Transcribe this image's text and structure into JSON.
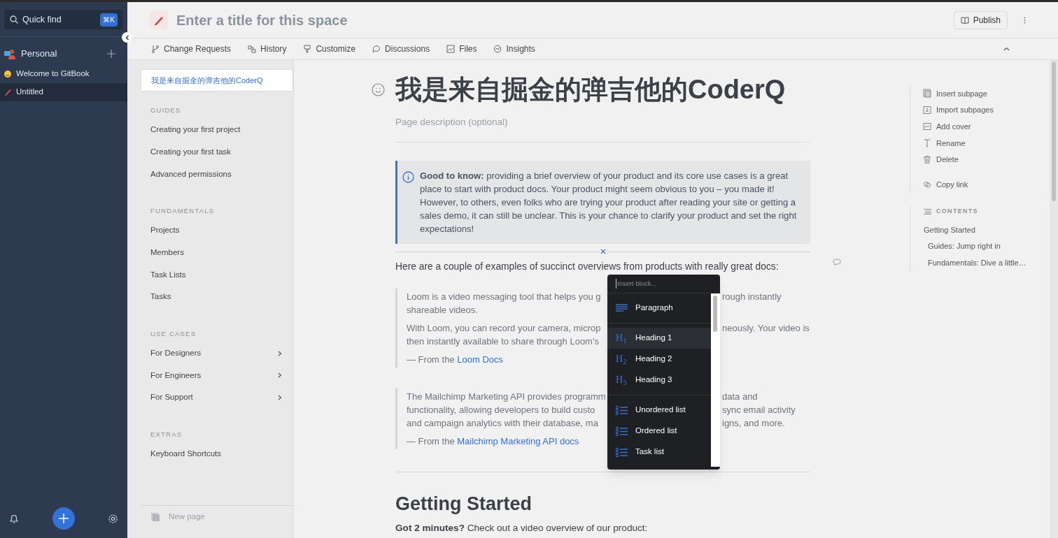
{
  "sidebar": {
    "search": {
      "placeholder": "Quick find",
      "shortcut": "⌘K"
    },
    "space": {
      "name": "Personal"
    },
    "pages": [
      {
        "title": "Welcome to GitBook",
        "kind": "emoji",
        "selected": false
      },
      {
        "title": "Untitled",
        "kind": "pencil",
        "selected": true
      }
    ]
  },
  "header": {
    "title_placeholder": "Enter a title for this space",
    "publish": "Publish"
  },
  "tabs": [
    {
      "label": "Change Requests",
      "kind": "branch"
    },
    {
      "label": "History",
      "kind": "history"
    },
    {
      "label": "Customize",
      "kind": "brush"
    },
    {
      "label": "Discussions",
      "kind": "bubble"
    },
    {
      "label": "Files",
      "kind": "image"
    },
    {
      "label": "Insights",
      "kind": "chart"
    }
  ],
  "nav": {
    "current_page": {
      "title": "我是来自掘金的弹吉他的CoderQ",
      "selected": true
    },
    "sections": [
      {
        "heading": "GUIDES",
        "items": [
          {
            "label": "Creating your first project",
            "expandable": false
          },
          {
            "label": "Creating your first task",
            "expandable": false
          },
          {
            "label": "Advanced permissions",
            "expandable": false
          }
        ]
      },
      {
        "heading": "FUNDAMENTALS",
        "items": [
          {
            "label": "Projects",
            "expandable": false
          },
          {
            "label": "Members",
            "expandable": false
          },
          {
            "label": "Task Lists",
            "expandable": false
          },
          {
            "label": "Tasks",
            "expandable": false
          }
        ]
      },
      {
        "heading": "USE CASES",
        "items": [
          {
            "label": "For Designers",
            "expandable": true
          },
          {
            "label": "For Engineers",
            "expandable": true
          },
          {
            "label": "For Support",
            "expandable": true
          }
        ]
      },
      {
        "heading": "EXTRAS",
        "items": [
          {
            "label": "Keyboard Shortcuts",
            "expandable": false
          }
        ]
      }
    ],
    "new_page": "New page"
  },
  "page": {
    "title": "我是来自掘金的弹吉他的CoderQ",
    "description_placeholder": "Page description (optional)",
    "callout": "**Good to know:** providing a brief overview of your product and its core use cases is a great place to start with product docs. Your product might seem obvious to you – you made it! However, to others, even folks who are trying your product after reading your site or getting a sales demo, it can still be unclear. This is your chance to clarify your product and set the right expectations!",
    "intro": "Here are a couple of examples of succinct overviews from products with really great docs:",
    "quotes": [
      {
        "paragraphs": [
          [
            {
              "left": "Loom is a video messaging tool that helps you g",
              "right": "rough instantly"
            },
            {
              "left": "shareable videos."
            }
          ],
          [
            {
              "left": "With Loom, you can record your camera, microp",
              "right": "neously. Your video is"
            },
            {
              "left": "then instantly available to share through Loom's"
            }
          ]
        ],
        "source": "— From the ",
        "link": "Loom Docs"
      },
      {
        "paragraphs": [
          [
            {
              "left": "The Mailchimp Marketing API provides programm",
              "right": "data and"
            },
            {
              "left": "functionality, allowing developers to build custo",
              "right": "sync email activity"
            },
            {
              "left": "and campaign analytics with their database, ma",
              "right": "igns, and more."
            }
          ]
        ],
        "source": "— From the ",
        "link": "Mailchimp Marketing API docs"
      }
    ],
    "heading": "Getting Started",
    "tail": "**Got 2 minutes?** Check out a video overview of our product:"
  },
  "insert_menu": {
    "placeholder": "Insert block...",
    "groups": [
      [
        {
          "label": "Paragraph",
          "kind": "paragraph",
          "selected": false
        }
      ],
      [
        {
          "label": "Heading 1",
          "kind": "heading",
          "icon": "H$_{1}$",
          "selected": true
        },
        {
          "label": "Heading 2",
          "kind": "heading",
          "icon": "H$_{2}$",
          "selected": false
        },
        {
          "label": "Heading 3",
          "kind": "heading",
          "icon": "H$_{3}$",
          "selected": false
        }
      ],
      [
        {
          "label": "Unordered list",
          "kind": "list",
          "selected": false
        },
        {
          "label": "Ordered list",
          "kind": "list",
          "selected": false
        },
        {
          "label": "Task list",
          "kind": "list",
          "selected": false
        }
      ]
    ]
  },
  "actions": [
    {
      "label": "Insert subpage",
      "kind": "subpage"
    },
    {
      "label": "Import subpages",
      "kind": "import"
    },
    {
      "label": "Add cover",
      "kind": "cover"
    },
    {
      "label": "Rename",
      "kind": "rename"
    },
    {
      "label": "Delete",
      "kind": "delete"
    },
    {
      "label": "Copy link",
      "kind": "link"
    }
  ],
  "contents": {
    "heading": "CONTENTS",
    "items": [
      {
        "label": "Getting Started",
        "children": [
          {
            "label": "Guides: Jump right in"
          },
          {
            "label": "Fundamentals: Dive a little…"
          }
        ]
      }
    ]
  }
}
